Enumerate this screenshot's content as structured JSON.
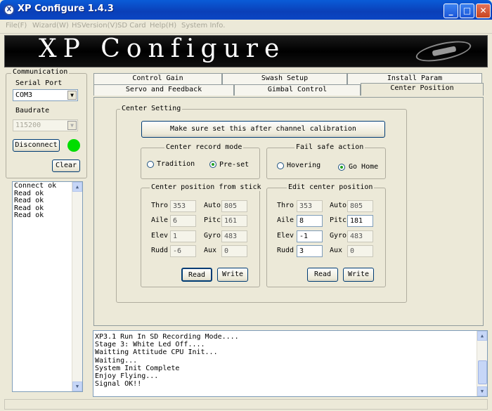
{
  "window": {
    "title": "XP Configure 1.4.3",
    "icon": "app-icon",
    "min": "_",
    "max": "□",
    "close": "✕"
  },
  "menu": [
    "File(F)",
    "Wizard(W)",
    "HSVersion(V)",
    "SD Card",
    "Help(H)",
    "System Info."
  ],
  "banner": {
    "title": "XP Configure"
  },
  "communication": {
    "group": "Communication",
    "serial_port_label": "Serial Port",
    "serial_port_value": "COM3",
    "baudrate_label": "Baudrate",
    "baudrate_value": "115200",
    "disconnect": "Disconnect",
    "status_color": "#00dd00",
    "clear": "Clear",
    "log": [
      "Connect ok",
      "Read ok",
      "Read ok",
      "Read ok",
      "Read ok"
    ]
  },
  "tabs": {
    "row1": [
      "Control Gain",
      "Swash Setup",
      "Install Param"
    ],
    "row2": [
      "Servo and Feedback",
      "Gimbal Control",
      "Center Position"
    ],
    "active": "Center Position"
  },
  "center": {
    "group": "Center Setting",
    "calib_button": "Make sure set this after channel calibration",
    "record_mode": {
      "label": "Center record mode",
      "opt1": "Tradition",
      "opt2": "Pre-set"
    },
    "failsafe": {
      "label": "Fail safe action",
      "opt1": "Hovering",
      "opt2": "Go Home"
    },
    "from_stick": {
      "label": "Center position from stick",
      "throl": "Thro",
      "thro": "353",
      "autol": "Auto",
      "auto": "805",
      "ailel": "Aile",
      "aile": "6",
      "pitcl": "Pitc",
      "pitc": "161",
      "elevl": "Elev",
      "elev": "1",
      "gyrol": "Gyro",
      "gyro": "483",
      "ruddl": "Rudd",
      "rudd": "-6",
      "auxl": "Aux",
      "aux": "0",
      "read": "Read",
      "write": "Write"
    },
    "edit": {
      "label": "Edit center position",
      "throl": "Thro",
      "thro": "353",
      "autol": "Auto",
      "auto": "805",
      "ailel": "Aile",
      "aile": "8",
      "pitcl": "Pitc",
      "pitc": "181",
      "elevl": "Elev",
      "elev": "-1",
      "gyrol": "Gyro",
      "gyro": "483",
      "ruddl": "Rudd",
      "rudd": "3",
      "auxl": "Aux",
      "aux": "0",
      "read": "Read",
      "write": "Write"
    }
  },
  "console": [
    "XP3.1 Run In SD Recording Mode....",
    "Stage 3: White Led Off....",
    "Waitting Attitude CPU Init...",
    "Waiting...",
    "System Init Complete",
    "Enjoy Flying...",
    "Signal OK!!"
  ]
}
